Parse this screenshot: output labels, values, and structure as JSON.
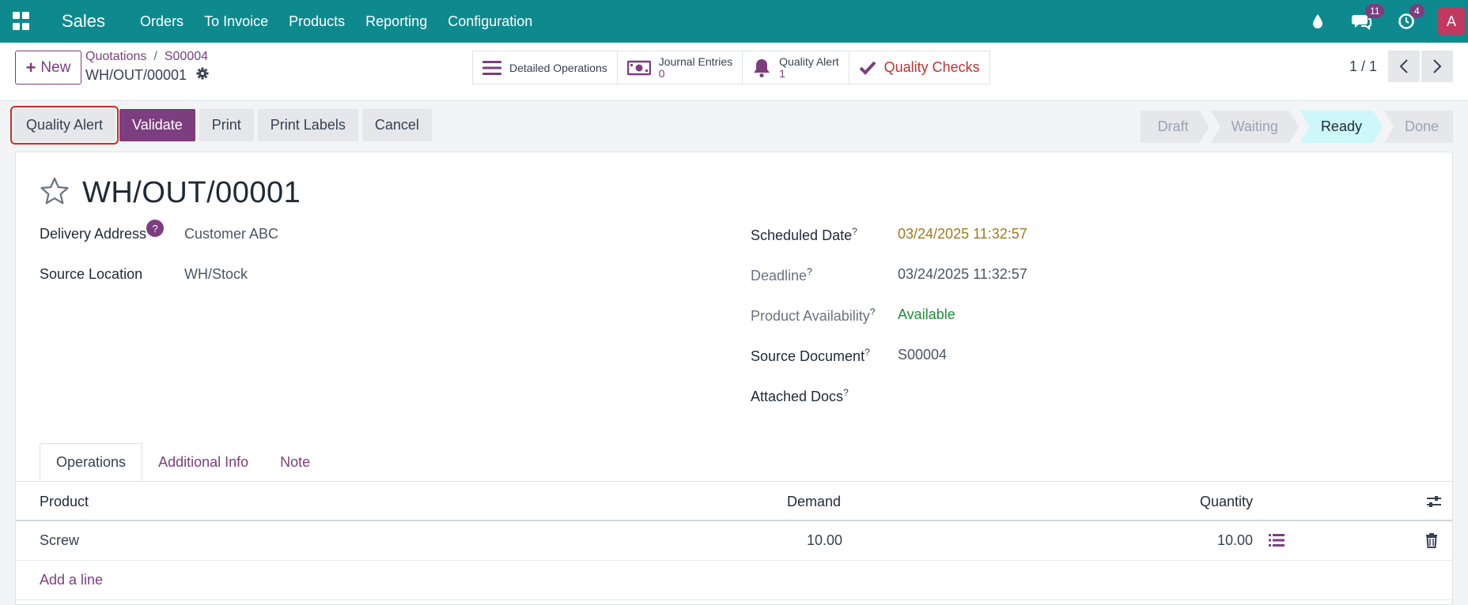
{
  "topnav": {
    "app_name": "Sales",
    "items": [
      "Orders",
      "To Invoice",
      "Products",
      "Reporting",
      "Configuration"
    ],
    "messages_count": "11",
    "activities_count": "4",
    "avatar_initial": "A"
  },
  "control": {
    "new_label": "New",
    "breadcrumb": [
      "Quotations",
      "S00004"
    ],
    "record_name": "WH/OUT/00001",
    "smart_buttons": {
      "detailed_operations": "Detailed Operations",
      "journal_entries_label": "Journal Entries",
      "journal_entries_value": "0",
      "quality_alert_label": "Quality Alert",
      "quality_alert_value": "1",
      "quality_checks": "Quality Checks"
    },
    "pager": "1 / 1"
  },
  "actions": [
    "Quality Alert",
    "Validate",
    "Print",
    "Print Labels",
    "Cancel"
  ],
  "stages": [
    "Draft",
    "Waiting",
    "Ready",
    "Done"
  ],
  "active_stage": "Ready",
  "record": {
    "title": "WH/OUT/00001",
    "delivery_address_label": "Delivery Address",
    "delivery_address": "Customer ABC",
    "source_location_label": "Source Location",
    "source_location": "WH/Stock",
    "scheduled_date_label": "Scheduled Date",
    "scheduled_date": "03/24/2025 11:32:57",
    "deadline_label": "Deadline",
    "deadline": "03/24/2025 11:32:57",
    "availability_label": "Product Availability",
    "availability": "Available",
    "source_document_label": "Source Document",
    "source_document": "S00004",
    "attached_docs_label": "Attached Docs"
  },
  "tabs": [
    "Operations",
    "Additional Info",
    "Note"
  ],
  "table": {
    "headers": {
      "product": "Product",
      "demand": "Demand",
      "quantity": "Quantity"
    },
    "rows": [
      {
        "product": "Screw",
        "demand": "10.00",
        "quantity": "10.00"
      }
    ],
    "add_line": "Add a line"
  },
  "colors": {
    "brand": "#0e8a8f",
    "primary": "#7c3e7e",
    "ready_stage": "#cdf7f9",
    "available": "#1f8e3b"
  }
}
